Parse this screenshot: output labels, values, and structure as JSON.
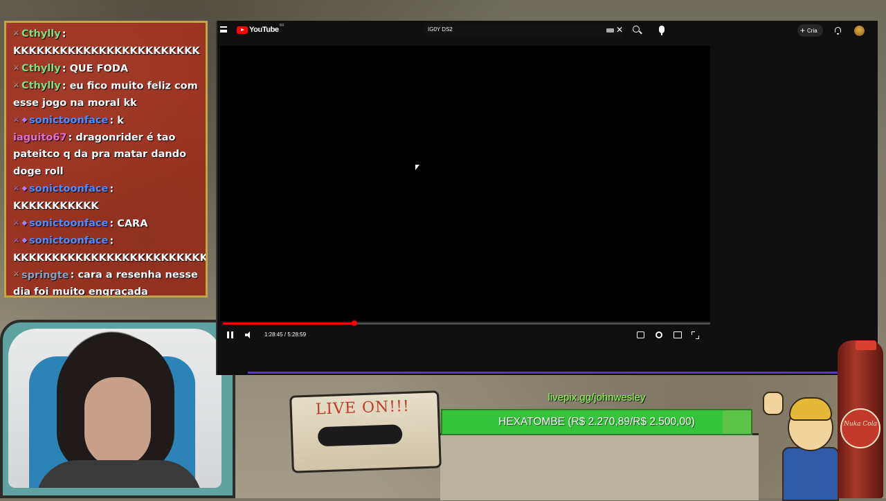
{
  "chat": {
    "messages": [
      {
        "badge": "mod",
        "user": "Cthylly",
        "user_color": "#7fe07a",
        "text": "KKKKKKKKKKKKKKKKKKKKKKKK"
      },
      {
        "badge": "mod",
        "user": "Cthylly",
        "user_color": "#7fe07a",
        "text": "QUE FODA"
      },
      {
        "badge": "mod",
        "user": "Cthylly",
        "user_color": "#7fe07a",
        "text": "eu fico muito feliz com esse jogo na moral kk"
      },
      {
        "badge": "sub",
        "user": "sonictoonface",
        "user_color": "#4e8cff",
        "text": "k"
      },
      {
        "badge": "",
        "user": "iaguito67",
        "user_color": "#e86bd0",
        "text": "dragonrider é tao pateitco q da pra matar dando doge roll"
      },
      {
        "badge": "sub",
        "user": "sonictoonface",
        "user_color": "#4e8cff",
        "text": "KKKKKKKKKKK"
      },
      {
        "badge": "sub",
        "user": "sonictoonface",
        "user_color": "#4e8cff",
        "text": "CARA"
      },
      {
        "badge": "sub",
        "user": "sonictoonface",
        "user_color": "#4e8cff",
        "text": "KKKKKKKKKKKKKKKKKKKKKKKKK"
      },
      {
        "badge": "mod",
        "user": "springte",
        "user_color": "#8aa0c0",
        "text": "cara a resenha nesse dia foi muito engraçada"
      }
    ]
  },
  "browser": {
    "logo_text": "YouTube",
    "logo_country": "BR",
    "search_value": "IG0Y DS2",
    "create_label": "Cria",
    "player": {
      "current_time": "1:28:45",
      "duration": "5:28:59",
      "time_display": "1:28:45 / 5:28:59",
      "progress_fraction": 0.27,
      "accent_color": "#ff0000"
    }
  },
  "overlay": {
    "cassette_label": "LIVE ON!!!",
    "donation_link": "livepix.gg/johnwesley",
    "goal_text": "HEXATOMBE (R$ 2.270,89/R$ 2.500,00)",
    "goal_current": 2270.89,
    "goal_target": 2500.0,
    "goal_color": "#35c43b",
    "bottle_label": "Nuka Cola"
  }
}
